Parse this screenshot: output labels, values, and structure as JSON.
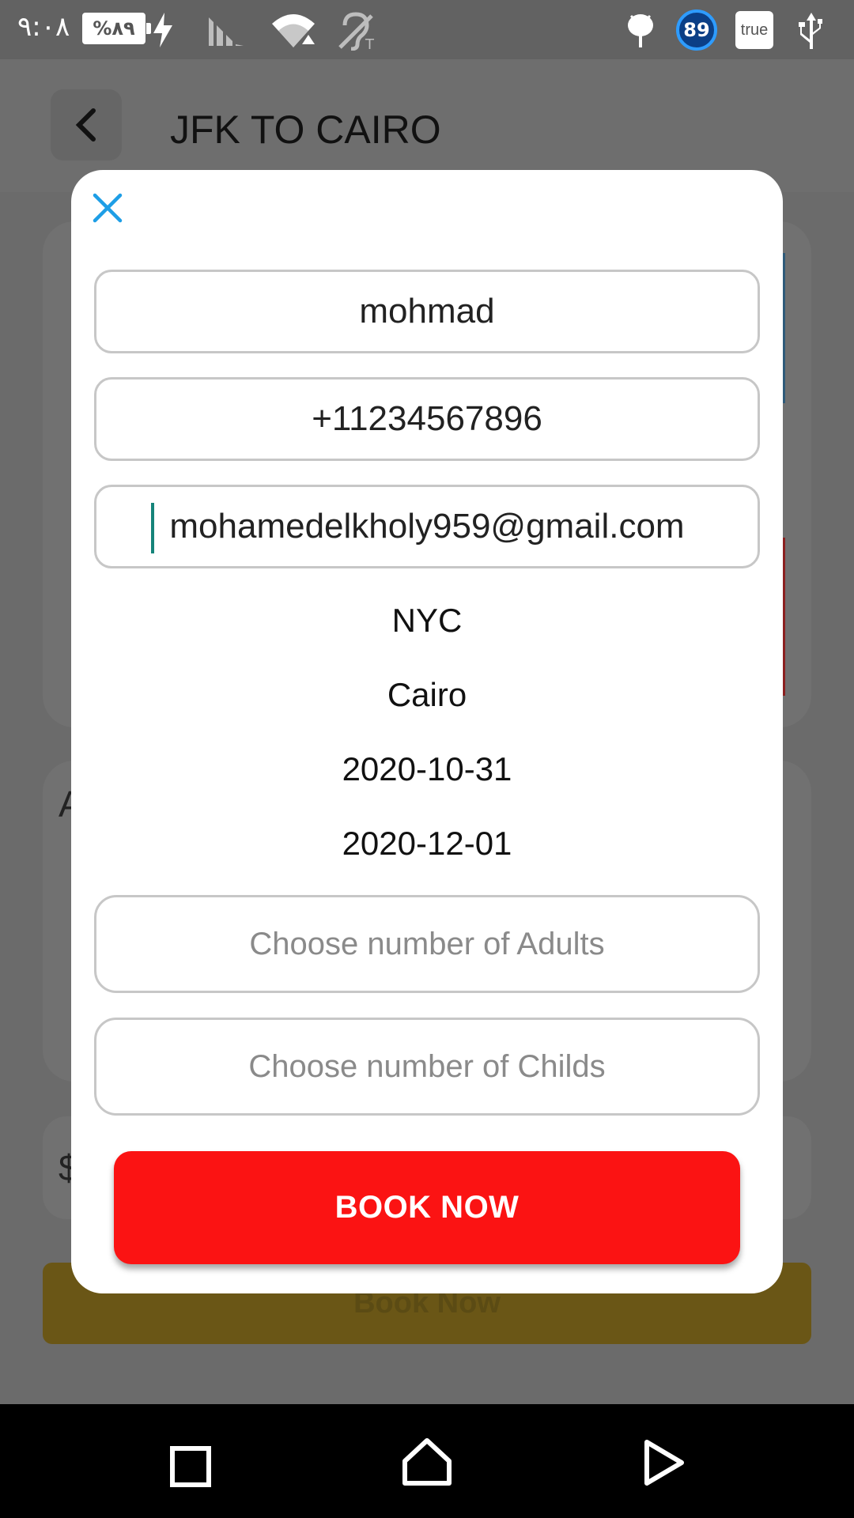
{
  "status_bar": {
    "time": "٩:٠٨",
    "battery": "%٨٩",
    "notification_badge": "89",
    "true_label": "true"
  },
  "app": {
    "title": "JFK TO CAIRO",
    "background_book_label": "Book Now",
    "background_letters": [
      "A",
      "$"
    ]
  },
  "dialog": {
    "name_value": "mohmad",
    "phone_value": "+11234567896",
    "email_value": "mohamedelkholy959@gmail.com",
    "from": "NYC",
    "to": "Cairo",
    "depart_date": "2020-10-31",
    "return_date": "2020-12-01",
    "adults_placeholder": "Choose number of Adults",
    "childs_placeholder": "Choose number of Childs",
    "book_label": "BOOK NOW"
  },
  "colors": {
    "accent_close": "#1e9ee6",
    "book_button": "#fb1313",
    "caret": "#15847a"
  },
  "icons": {
    "close": "close-icon",
    "back": "chevron-left-icon",
    "nav": [
      "recent-apps-icon",
      "home-icon",
      "back-triangle-icon"
    ]
  }
}
